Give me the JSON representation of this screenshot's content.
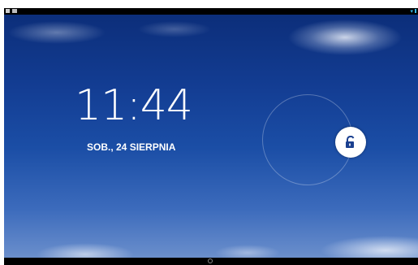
{
  "statusbar": {
    "left_icons": [
      "notification-icon",
      "image-notification-icon"
    ],
    "right_icons": [
      "wifi-icon",
      "battery-icon"
    ],
    "accent_color": "#36b8e8"
  },
  "lockscreen": {
    "time": "11:44",
    "date": "SOB., 24 SIERPNIA",
    "unlock_icon": "unlock-padlock-icon"
  },
  "navbar": {
    "home_icon": "home-circle-icon"
  },
  "colors": {
    "sky_top": "#0c2e7a",
    "sky_bottom": "#6b8fcc",
    "text": "#ffffff"
  }
}
